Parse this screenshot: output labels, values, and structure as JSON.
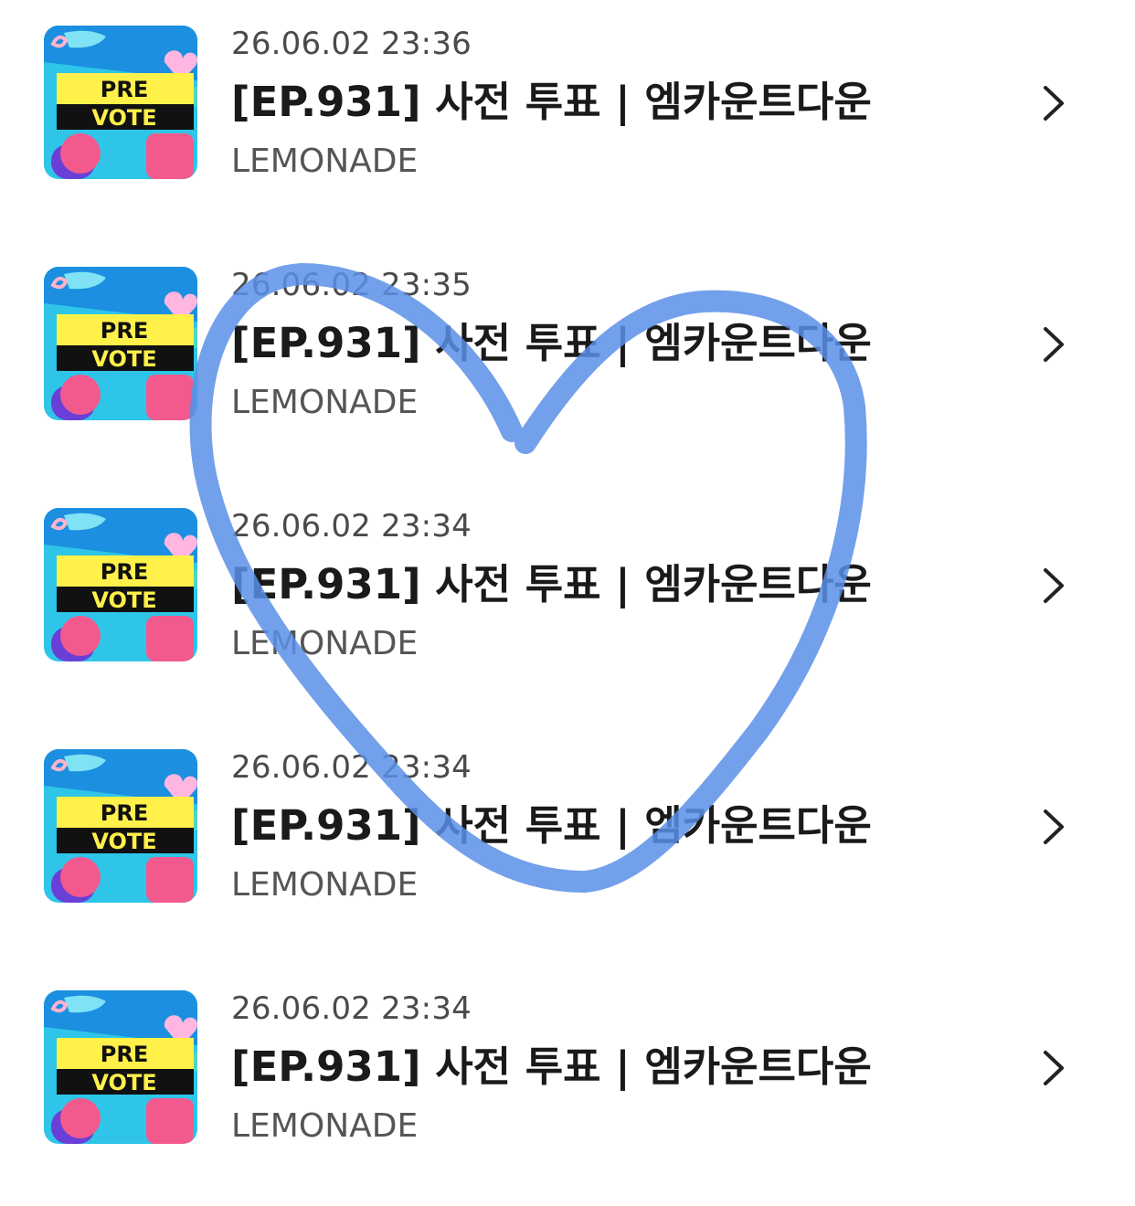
{
  "list": {
    "items": [
      {
        "date": "26.06.02 23:36",
        "title": "[EP.931] 사전 투표 | 엠카운트다운",
        "artist": "LEMONADE",
        "thumb_line1": "PRE",
        "thumb_line2": "VOTE"
      },
      {
        "date": "26.06.02 23:35",
        "title": "[EP.931] 사전 투표 | 엠카운트다운",
        "artist": "LEMONADE",
        "thumb_line1": "PRE",
        "thumb_line2": "VOTE"
      },
      {
        "date": "26.06.02 23:34",
        "title": "[EP.931] 사전 투표 | 엠카운트다운",
        "artist": "LEMONADE",
        "thumb_line1": "PRE",
        "thumb_line2": "VOTE"
      },
      {
        "date": "26.06.02 23:34",
        "title": "[EP.931] 사전 투표 | 엠카운트다운",
        "artist": "LEMONADE",
        "thumb_line1": "PRE",
        "thumb_line2": "VOTE"
      },
      {
        "date": "26.06.02 23:34",
        "title": "[EP.931] 사전 투표 | 엠카운트다운",
        "artist": "LEMONADE",
        "thumb_line1": "PRE",
        "thumb_line2": "VOTE"
      }
    ]
  },
  "icons": {
    "row_chevron": "chevron-right-icon",
    "overlay": "heart-doodle"
  },
  "colors": {
    "thumb_bg": "#2ec5e8",
    "thumb_yellow": "#fff04a",
    "thumb_pink": "#f25a8e",
    "thumb_purple": "#6a3fd8",
    "heart_stroke": "#5b8fe6"
  }
}
